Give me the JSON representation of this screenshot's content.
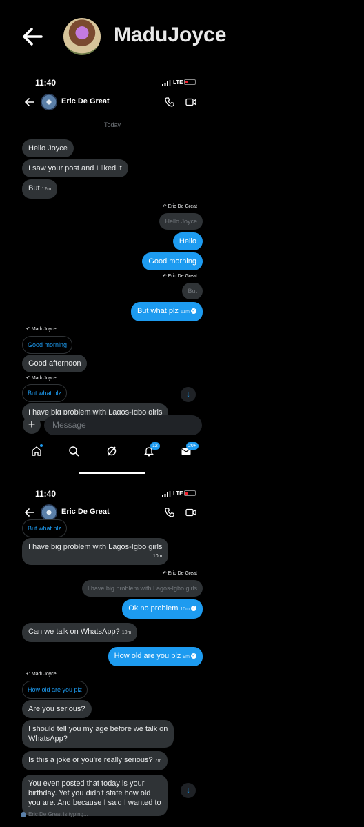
{
  "top": {
    "title": "MaduJoyce"
  },
  "status": {
    "time": "11:40",
    "network": "LTE"
  },
  "chat": {
    "contact": "Eric De Great",
    "day": "Today"
  },
  "shot1": {
    "messages": [
      {
        "text": "Hello Joyce"
      },
      {
        "text": "I saw your post and I liked it"
      },
      {
        "text": "But",
        "time": "12m"
      }
    ],
    "reply1_label": "Eric De Great",
    "reply1_quote": "Hello Joyce",
    "sent1": "Hello",
    "sent2": "Good morning",
    "reply2_label": "Eric De Great",
    "reply2_quote": "But",
    "sent3": "But what plz",
    "sent3_time": "11m",
    "reply3_label": "MaduJoyce",
    "reply3_quote": "Good morning",
    "recv4": "Good afternoon",
    "reply4_label": "MaduJoyce",
    "reply4_quote": "But what plz",
    "recv5_partial": "I have big problem with Lagos-Igbo girls"
  },
  "composer": {
    "placeholder": "Message"
  },
  "nav": {
    "notifications_badge": "12",
    "messages_badge": "20+"
  },
  "shot2": {
    "top_quote": "But what plz",
    "recv1": "I have big problem with Lagos-Igbo girls",
    "recv1_time": "10m",
    "reply1_label": "Eric De Great",
    "reply1_quote": "I have big problem with Lagos-Igbo girls",
    "sent1": "Ok no problem",
    "sent1_time": "10m",
    "recv2": "Can we talk on WhatsApp?",
    "recv2_time": "10m",
    "sent2": "How old are you plz",
    "sent2_time": "9m",
    "reply2_label": "MaduJoyce",
    "reply2_quote": "How old are you plz",
    "recv3": "Are you serious?",
    "recv4_line1": "I should tell you my age before we talk on",
    "recv4_line2": "WhatsApp?",
    "recv5": "Is this a joke or you're really serious?",
    "recv5_time": "7m",
    "recv6_line1": "You even posted that today is your",
    "recv6_line2": "birthday.  Yet you didn't state how old",
    "recv6_line3": "you are. And because I said I wanted to"
  },
  "typing": {
    "text": "Eric De Great is typing..."
  }
}
